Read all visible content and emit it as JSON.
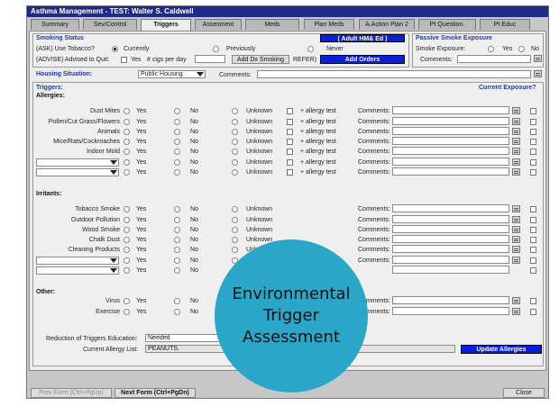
{
  "window": {
    "title": "Asthma Management - TEST: Walter S. Caldwell"
  },
  "tabs": [
    "Summary",
    "Sev/Control",
    "Triggers",
    "Assesment",
    "Meds",
    "Plan Meds",
    "A.Action Plan 2",
    "Pt Question.",
    "Pt Educ"
  ],
  "active_tab": "Triggers",
  "smoking": {
    "header": "Smoking Status",
    "adult_btn": "( Adult HM& Ed )",
    "ask_label": "(ASK) Use Tobacco?",
    "opt_currently": "Currently",
    "opt_previously": "Previously",
    "opt_never": "Never",
    "advise_label": "(ADVISE) Advised to Quit:",
    "yes_label": "Yes",
    "cigs_label": "# cigs per day",
    "add_dx_btn": "Add Dx Smoking",
    "refer_label": "REFER)",
    "add_orders_btn": "Add Orders"
  },
  "passive": {
    "header": "Passive Smoke Exposure",
    "label": "Smoke Exposure:",
    "yes": "Yes",
    "no": "No",
    "comments": "Comments:"
  },
  "housing": {
    "label": "Housing Situation:",
    "value": "Public Housing",
    "comments": "Comments:"
  },
  "triggers": {
    "header": "Triggers:",
    "current_exposure": "Current Exposure?",
    "allergies_header": "Allergies:",
    "irritants_header": "Irritants:",
    "other_header": "Other:",
    "yes": "Yes",
    "no": "No",
    "unknown": "Unknown",
    "allergy_test": "+ allergy test",
    "comments": "Comments:",
    "allergies": [
      "Dust Mites",
      "Pollen/Cut Grass/Flowers",
      "Animals",
      "Mice/Rats/Cockroaches",
      "Indoor Mold",
      "",
      ""
    ],
    "irritants": [
      "Tobacco Smoke",
      "Outdoor Pollution",
      "Wood Smoke",
      "Chalk Dust",
      "Cleaning Products",
      "",
      ""
    ],
    "other": [
      "Virus",
      "Exercise"
    ]
  },
  "education": {
    "label": "Reduction of Triggers Education:",
    "value": "Needed",
    "allergy_label": "Current Allergy List:",
    "allergy_value": "PEANUTS.",
    "update_btn": "Update Allergies"
  },
  "footer": {
    "prev": "Prev Form (Ctrl+PgUp)",
    "next": "Next Form (Ctrl+PgDn)",
    "close": "Close"
  },
  "overlay": {
    "line1": "Environmental",
    "line2": "Trigger",
    "line3": "Assessment"
  },
  "colors": {
    "title_bar": "#1f2a8a",
    "header_text": "#1e3aa6",
    "button_blue": "#0a1fdc",
    "overlay": "#2aa6c9"
  }
}
